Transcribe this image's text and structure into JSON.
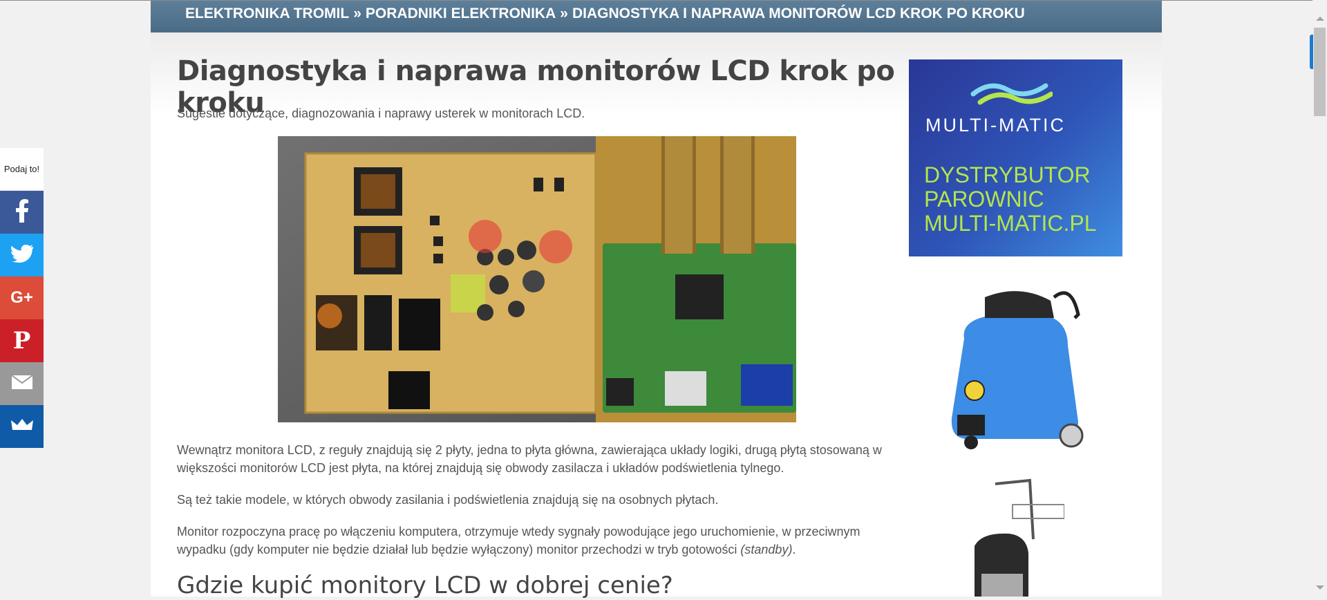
{
  "breadcrumb": {
    "home": "ELEKTRONIKA TROMIL",
    "separator": "»",
    "section": "PORADNIKI ELEKTRONIKA",
    "current": "DIAGNOSTYKA I NAPRAWA MONITORÓW LCD KROK PO KROKU"
  },
  "article": {
    "title": "Diagnostyka i naprawa monitorów LCD krok po kroku",
    "subtitle": "Sugestie dotyczące, diagnozowania i naprawy usterek w monitorach LCD.",
    "paragraph1": "Wewnątrz monitora LCD, z reguły znajdują się 2 płyty, jedna to płyta główna, zawierająca układy logiki, drugą płytą stosowaną w większości monitorów LCD jest płyta, na której znajdują się obwody zasilacza i układów podświetlenia tylnego.",
    "paragraph2": "Są też takie modele, w których obwody zasilania i podświetlenia znajdują się na osobnych płytach.",
    "paragraph3_main": "Monitor rozpoczyna pracę po włączeniu komputera, otrzymuje wtedy sygnały powodujące jego uruchomienie, w przeciwnym wypadku (gdy komputer nie będzie działał lub będzie wyłączony) monitor przechodzi w tryb gotowości ",
    "paragraph3_italic": "(standby)",
    "paragraph3_end": ".",
    "heading2": "Gdzie kupić monitory LCD w dobrej cenie?"
  },
  "sidebar_ad": {
    "brand": "MULTI-MATIC",
    "line1": "DYSTRYBUTOR",
    "line2": "PAROWNIC",
    "line3": "MULTI-MATIC.PL",
    "bg_color": "#2f4fb5",
    "text_color": "#b4e64a"
  },
  "share": {
    "label": "Podaj to!",
    "buttons": [
      {
        "name": "facebook",
        "icon": "facebook-icon",
        "color": "#3b5998"
      },
      {
        "name": "twitter",
        "icon": "twitter-icon",
        "color": "#1da1f2"
      },
      {
        "name": "google-plus",
        "icon": "google-plus-icon",
        "color": "#dd4b39"
      },
      {
        "name": "pinterest",
        "icon": "pinterest-icon",
        "color": "#cb2027"
      },
      {
        "name": "email",
        "icon": "email-icon",
        "color": "#999999"
      },
      {
        "name": "sumome",
        "icon": "crown-icon",
        "color": "#0f5ba7"
      }
    ]
  }
}
